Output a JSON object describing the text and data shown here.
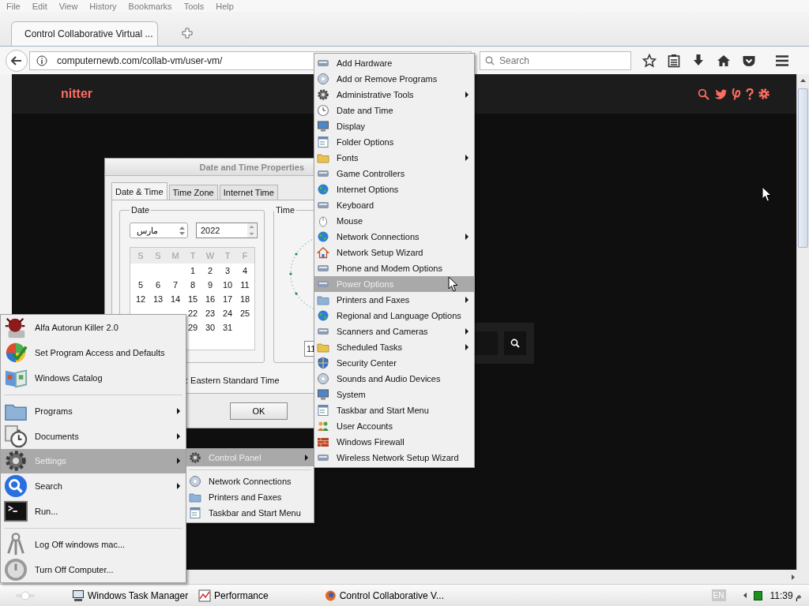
{
  "browser": {
    "menu": [
      "File",
      "Edit",
      "View",
      "History",
      "Bookmarks",
      "Tools",
      "Help"
    ],
    "tab": {
      "title": "Control Collaborative Virtual ..."
    },
    "address": "computernewb.com/collab-vm/user-vm/",
    "search": {
      "placeholder": "Search"
    }
  },
  "page": {
    "logo": "nitter"
  },
  "date_time_dialog": {
    "title": "Date and Time Properties",
    "tabs": [
      {
        "label": "Date & Time",
        "selected": true
      },
      {
        "label": "Time Zone",
        "selected": false
      },
      {
        "label": "Internet Time",
        "selected": false
      }
    ],
    "date_group": "Date",
    "month": "مارس",
    "year": "2022",
    "weekdays": [
      "S",
      "S",
      "M",
      "T",
      "W",
      "T",
      "F"
    ],
    "weeks": [
      {
        "kind": "end",
        "days": [
          "1",
          "2",
          "3",
          "4"
        ]
      },
      {
        "kind": "full",
        "days": [
          "5",
          "6",
          "7",
          "8",
          "9",
          "10",
          "11"
        ]
      },
      {
        "kind": "full",
        "days": [
          "12",
          "13",
          "14",
          "15",
          "16",
          "17",
          "18"
        ]
      },
      {
        "kind": "covered_start",
        "days": [
          "22",
          "23",
          "24",
          "25"
        ]
      },
      {
        "kind": "covered_start",
        "days": [
          "29",
          "30",
          "31"
        ]
      }
    ],
    "time_group": "Time",
    "time_value": "11",
    "time_zone": ": Eastern Standard Time",
    "buttons": [
      "OK"
    ]
  },
  "start_menu": {
    "items": [
      {
        "kind": "item",
        "label": "Alfa Autorun Killer 2.0",
        "submenu": false,
        "selected": false
      },
      {
        "kind": "item",
        "label": "Set Program Access and Defaults",
        "submenu": false,
        "selected": false
      },
      {
        "kind": "item",
        "label": "Windows Catalog",
        "submenu": false,
        "selected": false
      },
      {
        "kind": "separator"
      },
      {
        "kind": "item",
        "label": "Programs",
        "submenu": true,
        "selected": false
      },
      {
        "kind": "item",
        "label": "Documents",
        "submenu": true,
        "selected": false
      },
      {
        "kind": "item",
        "label": "Settings",
        "submenu": true,
        "selected": true
      },
      {
        "kind": "item",
        "label": "Search",
        "submenu": true,
        "selected": false
      },
      {
        "kind": "item",
        "label": "Run...",
        "submenu": false,
        "selected": false
      },
      {
        "kind": "separator"
      },
      {
        "kind": "item",
        "label": "Log Off windows mac...",
        "submenu": false,
        "selected": false
      },
      {
        "kind": "item",
        "label": "Turn Off Computer...",
        "submenu": false,
        "selected": false
      }
    ]
  },
  "settings_menu": {
    "items": [
      {
        "kind": "item",
        "label": "Control Panel",
        "submenu": true,
        "selected": true
      },
      {
        "kind": "separator"
      },
      {
        "kind": "item",
        "label": "Network Connections",
        "submenu": false,
        "selected": false
      },
      {
        "kind": "item",
        "label": "Printers and Faxes",
        "submenu": false,
        "selected": false
      },
      {
        "kind": "item",
        "label": "Taskbar and Start Menu",
        "submenu": false,
        "selected": false
      }
    ]
  },
  "control_panel_menu": {
    "items": [
      {
        "label": "Add Hardware",
        "submenu": false,
        "selected": false
      },
      {
        "label": "Add or Remove Programs",
        "submenu": false,
        "selected": false
      },
      {
        "label": "Administrative Tools",
        "submenu": true,
        "selected": false
      },
      {
        "label": "Date and Time",
        "submenu": false,
        "selected": false
      },
      {
        "label": "Display",
        "submenu": false,
        "selected": false
      },
      {
        "label": "Folder Options",
        "submenu": false,
        "selected": false
      },
      {
        "label": "Fonts",
        "submenu": true,
        "selected": false
      },
      {
        "label": "Game Controllers",
        "submenu": false,
        "selected": false
      },
      {
        "label": "Internet Options",
        "submenu": false,
        "selected": false
      },
      {
        "label": "Keyboard",
        "submenu": false,
        "selected": false
      },
      {
        "label": "Mouse",
        "submenu": false,
        "selected": false
      },
      {
        "label": "Network Connections",
        "submenu": true,
        "selected": false
      },
      {
        "label": "Network Setup Wizard",
        "submenu": false,
        "selected": false
      },
      {
        "label": "Phone and Modem Options",
        "submenu": false,
        "selected": false
      },
      {
        "label": "Power Options",
        "submenu": false,
        "selected": true
      },
      {
        "label": "Printers and Faxes",
        "submenu": true,
        "selected": false
      },
      {
        "label": "Regional and Language Options",
        "submenu": false,
        "selected": false
      },
      {
        "label": "Scanners and Cameras",
        "submenu": true,
        "selected": false
      },
      {
        "label": "Scheduled Tasks",
        "submenu": true,
        "selected": false
      },
      {
        "label": "Security Center",
        "submenu": false,
        "selected": false
      },
      {
        "label": "Sounds and Audio Devices",
        "submenu": false,
        "selected": false
      },
      {
        "label": "System",
        "submenu": false,
        "selected": false
      },
      {
        "label": "Taskbar and Start Menu",
        "submenu": false,
        "selected": false
      },
      {
        "label": "User Accounts",
        "submenu": false,
        "selected": false
      },
      {
        "label": "Windows Firewall",
        "submenu": false,
        "selected": false
      },
      {
        "label": "Wireless Network Setup Wizard",
        "submenu": false,
        "selected": false
      }
    ]
  },
  "taskbar": {
    "items": [
      {
        "label": "Windows Task Manager"
      },
      {
        "label": "Performance"
      },
      {
        "label": "Control Collaborative V..."
      }
    ],
    "language": "EN",
    "clock": "11:39 م"
  }
}
